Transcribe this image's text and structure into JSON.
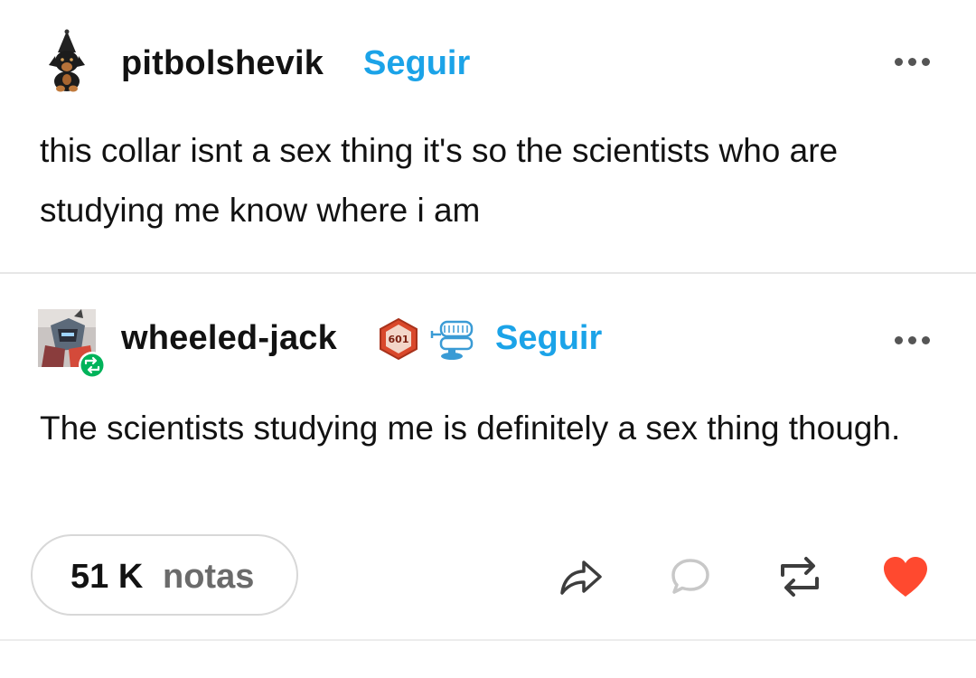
{
  "original_post": {
    "username": "pitbolshevik",
    "follow_label": "Seguir",
    "text": "this collar isnt a sex thing it's so the scientists who are studying me know where i am",
    "avatar_icon": "dog-with-party-hat-avatar"
  },
  "reblog": {
    "username": "wheeled-jack",
    "follow_label": "Seguir",
    "text": "The scientists studying me is definitely a sex thing though.",
    "avatar_icon": "robot-character-avatar",
    "reblog_badge_icon": "reblog-badge-icon",
    "badges": [
      {
        "icon": "hexagon-badge-icon",
        "label": "601",
        "color": "#d9482b"
      },
      {
        "icon": "wind-up-teeth-badge-icon",
        "color": "#3a9bd5"
      }
    ]
  },
  "footer": {
    "notes_count": "51 K",
    "notes_label": "notas",
    "actions": [
      {
        "icon": "share-arrow-icon"
      },
      {
        "icon": "comment-bubble-icon"
      },
      {
        "icon": "reblog-icon"
      },
      {
        "icon": "heart-icon",
        "color": "#ff492f"
      }
    ]
  },
  "colors": {
    "accent_blue": "#1ba3e8",
    "liked_red": "#ff492f",
    "reblog_green": "#00b35a"
  }
}
